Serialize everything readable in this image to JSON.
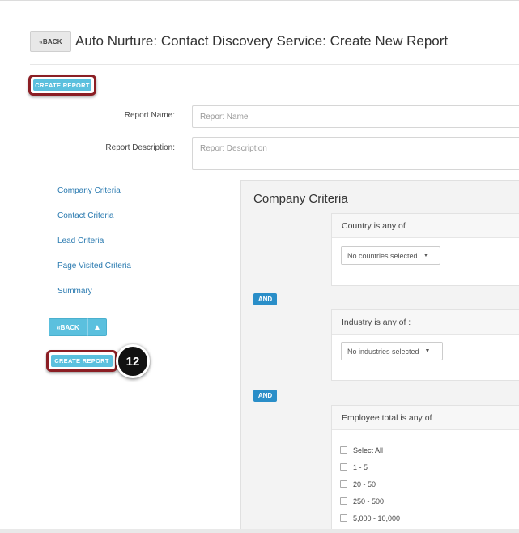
{
  "header": {
    "back_label": "⯇◀BACK",
    "back_text": "«BACK",
    "title": "Auto Nurture: Contact Discovery Service: Create New Report"
  },
  "actions": {
    "create_report_top": "CREATE REPORT",
    "create_report_side": "CREATE REPORT"
  },
  "form": {
    "report_name_label": "Report Name:",
    "report_name_placeholder": "Report Name",
    "report_description_label": "Report Description:",
    "report_description_placeholder": "Report Description"
  },
  "sidenav": {
    "items": [
      {
        "label": "Company Criteria"
      },
      {
        "label": "Contact Criteria"
      },
      {
        "label": "Lead Criteria"
      },
      {
        "label": "Page Visited Criteria"
      },
      {
        "label": "Summary"
      }
    ]
  },
  "nav_buttons": {
    "back_label": "«BACK",
    "up_icon": "arrow-up-icon",
    "up_glyph": "🡅"
  },
  "step_badge": "12",
  "panel": {
    "title": "Company Criteria",
    "country": {
      "heading": "Country is any of",
      "dropdown_value": "No countries selected"
    },
    "and_label_1": "AND",
    "industry": {
      "heading": "Industry is any of :",
      "dropdown_value": "No industries selected"
    },
    "and_label_2": "AND",
    "employee": {
      "heading": "Employee total is any of",
      "options": [
        {
          "label": "Select All",
          "checked": false
        },
        {
          "label": "1 - 5",
          "checked": false
        },
        {
          "label": "20 - 50",
          "checked": false
        },
        {
          "label": "250 - 500",
          "checked": false
        },
        {
          "label": "5,000 - 10,000",
          "checked": false
        }
      ]
    }
  },
  "colors": {
    "accent": "#5bc0de",
    "and_badge": "#2a8ec8",
    "highlight_border": "#8b1e24",
    "link": "#2a7ab0"
  }
}
